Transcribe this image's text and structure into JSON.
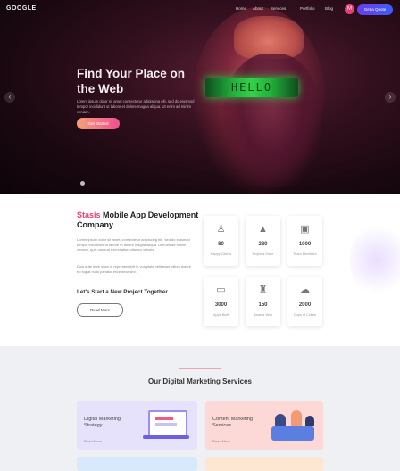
{
  "header": {
    "logo": "GOOGLE",
    "nav": [
      "Home",
      "About",
      "Services",
      "Portfolio",
      "Blog"
    ],
    "user_initial": "M",
    "cta": "Get a Quote"
  },
  "hero": {
    "title": "Find Your Place on the Web",
    "subtitle": "Lorem ipsum dolor sit amet consectetur adipiscing elit, sed do eiusmod tempor incididunt ut labore et dolore magna aliqua. Ut enim ad minim veniam.",
    "button": "Get Started",
    "visor_text": "HELLO",
    "prev_icon": "chevron-left-icon",
    "next_icon": "chevron-right-icon"
  },
  "about": {
    "title_accent": "Stasis",
    "title_rest": "Mobile App Development Company",
    "paragraph1": "Lorem ipsum dolor sit amet, consectetur adipiscing elit, sed do eiusmod tempor incididunt ut labore et dolore magna aliqua. Ut enim ad minim veniam, quis nostrud exercitation ullamco laboris.",
    "paragraph2": "Duis aute irure dolor in reprehenderit in voluptate velit esse cillum dolore eu fugiat nulla pariatur excepteur sint.",
    "subtitle": "Let's Start a New Project Together",
    "button": "Read More"
  },
  "stats": [
    {
      "icon": "person-icon",
      "value": "80",
      "label": "Happy Clients"
    },
    {
      "icon": "people-icon",
      "value": "280",
      "label": "Projects Done"
    },
    {
      "icon": "briefcase-icon",
      "value": "1000",
      "label": "Team Members"
    },
    {
      "icon": "monitor-icon",
      "value": "3000",
      "label": "Apps Built"
    },
    {
      "icon": "trophy-icon",
      "value": "150",
      "label": "Awards Won"
    },
    {
      "icon": "cloud-icon",
      "value": "2000",
      "label": "Cups of Coffee"
    }
  ],
  "services": {
    "section_title": "Our Digital Marketing Services",
    "items": [
      {
        "title": "Digital Marketing Strategy",
        "link": "Read More",
        "icon": "laptop-illustration-icon"
      },
      {
        "title": "Content Marketing Services",
        "link": "Read More",
        "icon": "team-illustration-icon"
      }
    ]
  }
}
